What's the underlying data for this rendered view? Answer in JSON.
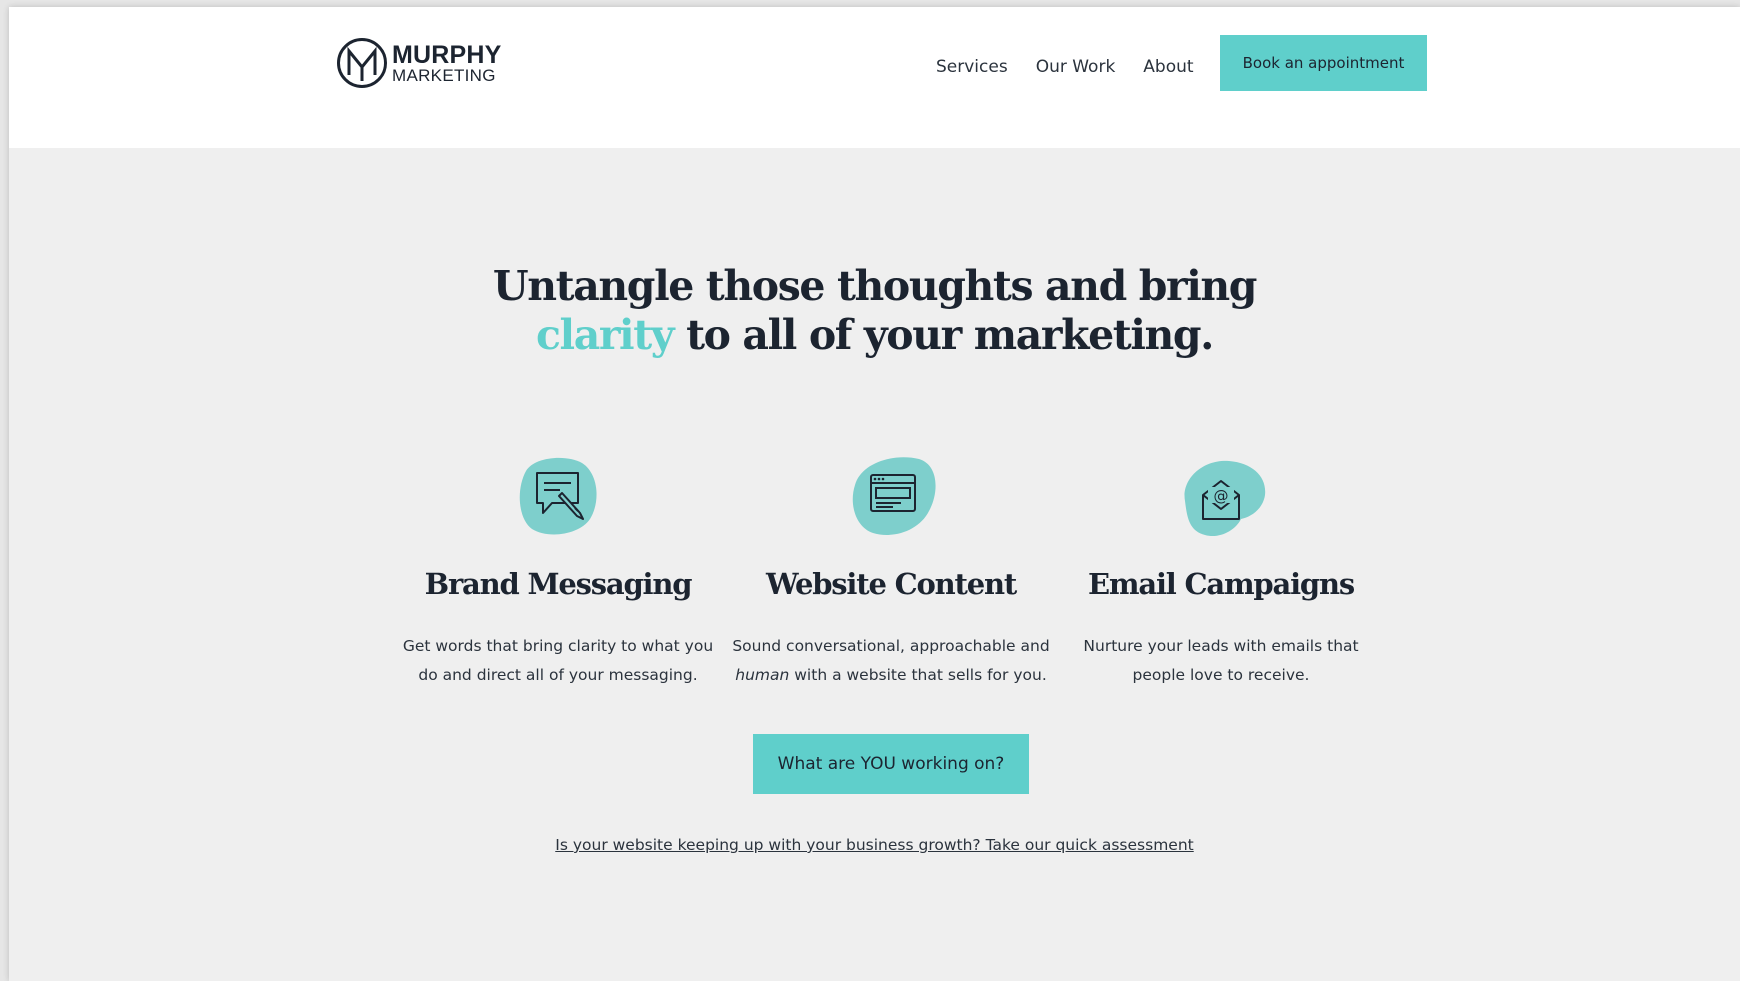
{
  "header": {
    "logo": {
      "name": "MURPHY",
      "sub": "MARKETING",
      "icon": "m-monogram-logo-icon"
    },
    "nav": [
      {
        "label": "Services"
      },
      {
        "label": "Our Work"
      },
      {
        "label": "About"
      }
    ],
    "book_button": "Book an appointment"
  },
  "hero": {
    "line1": "Untangle those thoughts and bring",
    "accent_word": "clarity",
    "line2_rest": " to all of your marketing."
  },
  "services": [
    {
      "icon": "message-pen-icon",
      "title": "Brand Messaging",
      "desc_line1": "Get words that bring clarity to what you",
      "desc_line2": "do and direct all of your messaging."
    },
    {
      "icon": "browser-window-icon",
      "title": "Website Content",
      "desc_line1": "Sound conversational, approachable and",
      "desc_em": "human",
      "desc_line2": " with a website that sells for you."
    },
    {
      "icon": "envelope-at-icon",
      "title": "Email Campaigns",
      "desc_line1": "Nurture your leads with emails that",
      "desc_line2": "people love to receive."
    }
  ],
  "cta_button": "What are YOU working on?",
  "assessment_link": "Is your website keeping up with your business growth? Take our quick assessment",
  "colors": {
    "accent": "#5fcfcb",
    "text": "#1c2430",
    "background": "#efefef"
  }
}
